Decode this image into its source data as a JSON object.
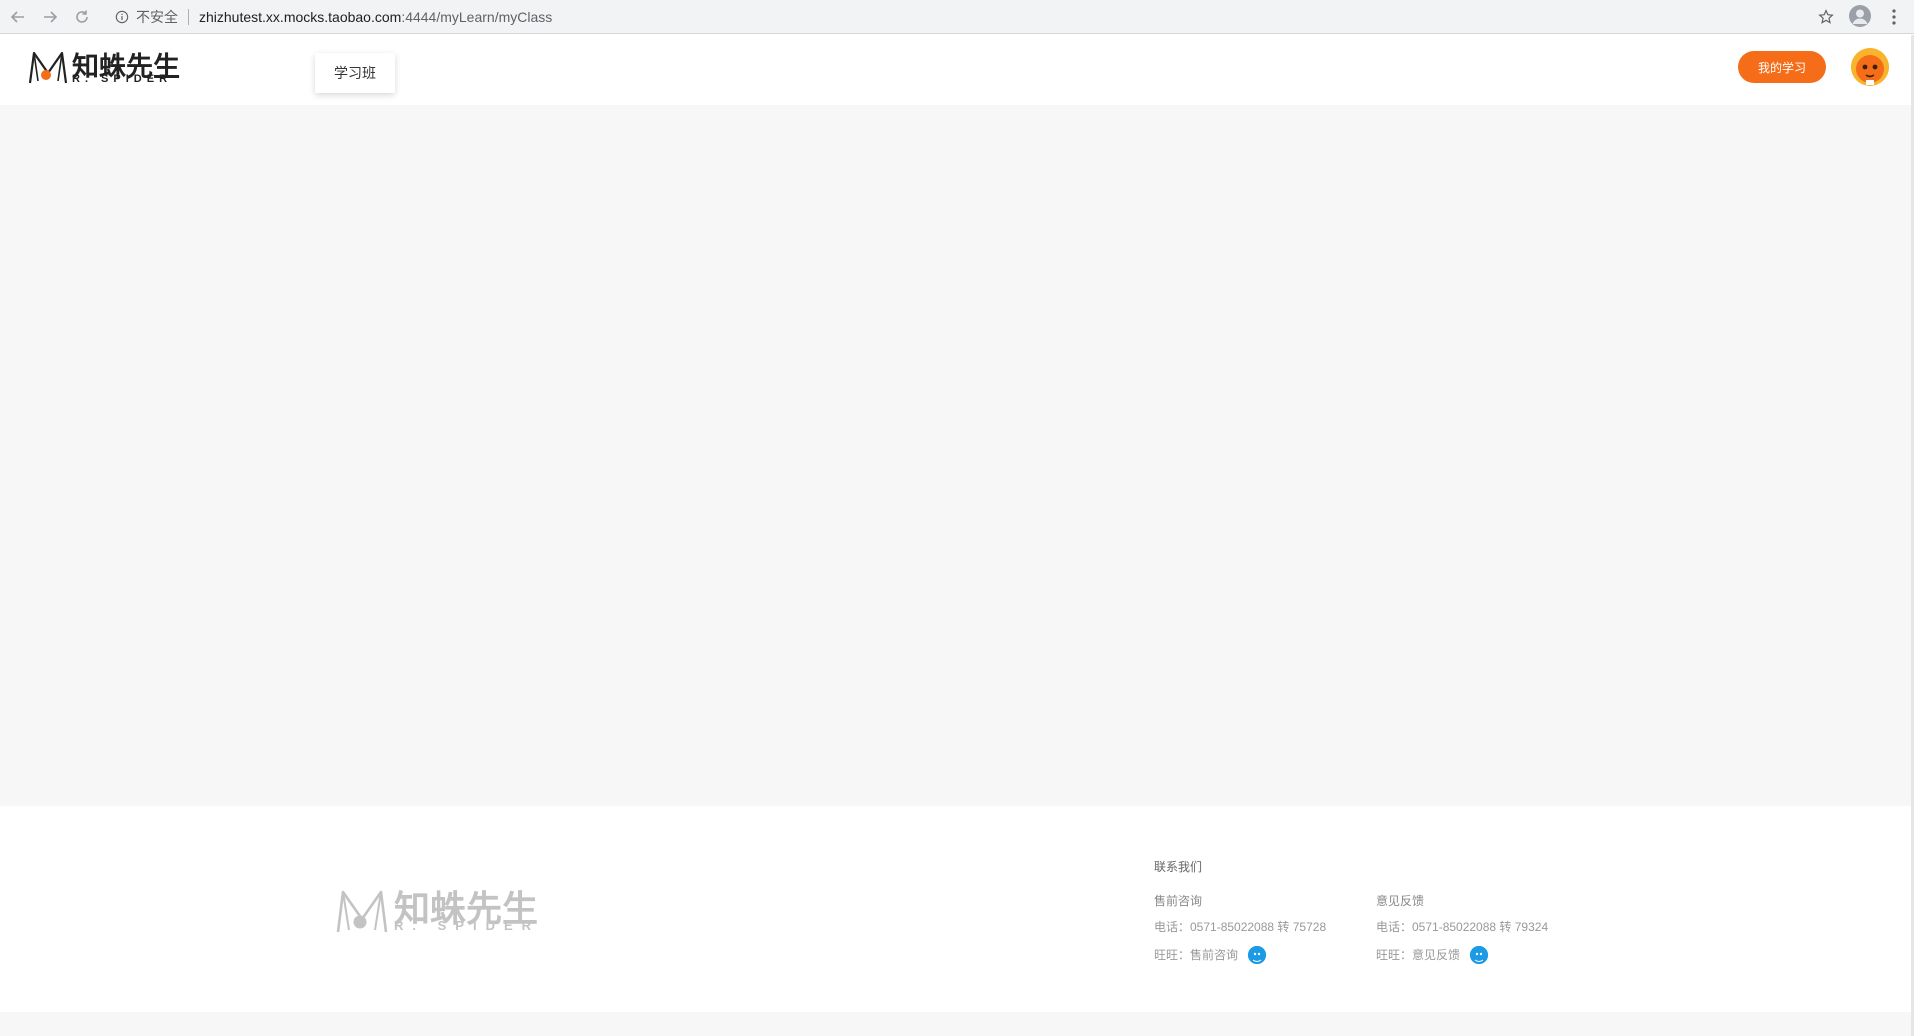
{
  "browser": {
    "security_label": "不安全",
    "url_host": "zhizhutest.xx.mocks.taobao.com",
    "url_path": ":4444/myLearn/myClass",
    "icons": [
      "back-icon",
      "forward-icon",
      "reload-icon",
      "info-icon",
      "star-icon",
      "profile-icon",
      "menu-icon"
    ]
  },
  "header": {
    "logo_cn": "知蛛先生",
    "logo_en": "R. SPIDER",
    "tab_label": "学习班",
    "my_learn_label": "我的学习",
    "accent_color": "#f56d19"
  },
  "footer": {
    "logo_cn": "知蛛先生",
    "logo_en": "R. SPIDER",
    "contact_title": "联系我们",
    "presale": {
      "title": "售前咨询",
      "phone": "电话：0571-85022088 转 75728",
      "wangwang": "旺旺：售前咨询"
    },
    "feedback": {
      "title": "意见反馈",
      "phone": "电话：0571-85022088 转 79324",
      "wangwang": "旺旺：意见反馈"
    }
  }
}
